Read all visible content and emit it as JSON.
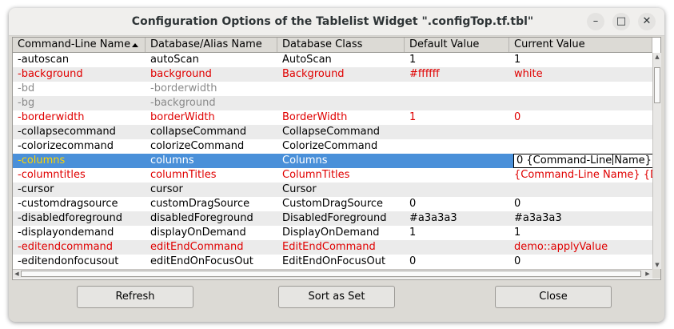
{
  "window": {
    "title": "Configuration Options of the Tablelist Widget \".configTop.tf.tbl\"",
    "minimize_glyph": "–",
    "maximize_glyph": "□",
    "close_glyph": "✕"
  },
  "table": {
    "columns": [
      "Command-Line Name",
      "Database/Alias Name",
      "Database Class",
      "Default Value",
      "Current Value"
    ],
    "sort_column": "Command-Line Name",
    "rows": [
      {
        "c": [
          "-autoscan",
          "autoScan",
          "AutoScan",
          "1",
          "1"
        ],
        "style": ""
      },
      {
        "c": [
          "-background",
          "background",
          "Background",
          "#ffffff",
          "white"
        ],
        "style": "red"
      },
      {
        "c": [
          "-bd",
          "-borderwidth",
          "",
          "",
          ""
        ],
        "style": "gray"
      },
      {
        "c": [
          "-bg",
          "-background",
          "",
          "",
          ""
        ],
        "style": "gray"
      },
      {
        "c": [
          "-borderwidth",
          "borderWidth",
          "BorderWidth",
          "1",
          "0"
        ],
        "style": "red"
      },
      {
        "c": [
          "-collapsecommand",
          "collapseCommand",
          "CollapseCommand",
          "",
          ""
        ],
        "style": ""
      },
      {
        "c": [
          "-colorizecommand",
          "colorizeCommand",
          "ColorizeCommand",
          "",
          ""
        ],
        "style": ""
      },
      {
        "c": [
          "-columns",
          "columns",
          "Columns",
          "",
          ""
        ],
        "style": "selected"
      },
      {
        "c": [
          "-columntitles",
          "columnTitles",
          "ColumnTitles",
          "",
          "{Command-Line Name} {Da"
        ],
        "style": "red"
      },
      {
        "c": [
          "-cursor",
          "cursor",
          "Cursor",
          "",
          ""
        ],
        "style": ""
      },
      {
        "c": [
          "-customdragsource",
          "customDragSource",
          "CustomDragSource",
          "0",
          "0"
        ],
        "style": ""
      },
      {
        "c": [
          "-disabledforeground",
          "disabledForeground",
          "DisabledForeground",
          "#a3a3a3",
          "#a3a3a3"
        ],
        "style": ""
      },
      {
        "c": [
          "-displayondemand",
          "displayOnDemand",
          "DisplayOnDemand",
          "1",
          "1"
        ],
        "style": ""
      },
      {
        "c": [
          "-editendcommand",
          "editEndCommand",
          "EditEndCommand",
          "",
          "demo::applyValue"
        ],
        "style": "red"
      },
      {
        "c": [
          "-editendonfocusout",
          "editEndOnFocusOut",
          "EditEndOnFocusOut",
          "0",
          "0"
        ],
        "style": ""
      }
    ],
    "editor": {
      "text_before_caret": "0 {Command-Line",
      "text_after_caret": "Name} le"
    }
  },
  "buttons": {
    "refresh": "Refresh",
    "sort_as_set": "Sort as Set",
    "close": "Close"
  },
  "colors": {
    "selection": "#4a90d9",
    "non_default_text": "#e00000",
    "alias_text": "#8a8a8a",
    "selected_non_default": "#ffd400"
  }
}
